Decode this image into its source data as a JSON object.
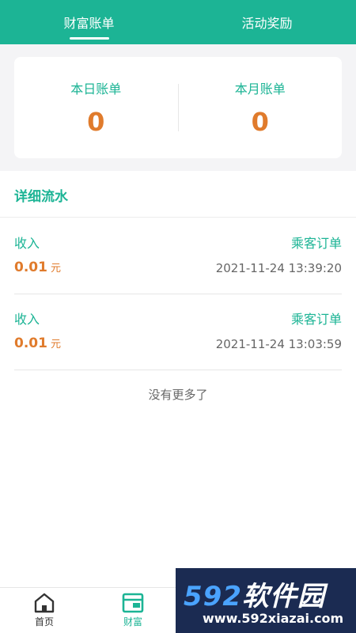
{
  "tabs": [
    {
      "label": "财富账单",
      "active": true
    },
    {
      "label": "活动奖励",
      "active": false
    }
  ],
  "summary": {
    "daily_label": "本日账单",
    "daily_value": "0",
    "monthly_label": "本月账单",
    "monthly_value": "0"
  },
  "detail": {
    "title": "详细流水",
    "records": [
      {
        "type": "收入",
        "source": "乘客订单",
        "amount": "0.01",
        "unit": "元",
        "time": "2021-11-24 13:39:20"
      },
      {
        "type": "收入",
        "source": "乘客订单",
        "amount": "0.01",
        "unit": "元",
        "time": "2021-11-24 13:03:59"
      }
    ],
    "no_more": "没有更多了"
  },
  "bottom_nav": [
    {
      "label": "首页",
      "icon": "home-icon",
      "active": false
    },
    {
      "label": "财富",
      "icon": "wallet-icon",
      "active": true
    }
  ],
  "watermark": {
    "logo_digits": "592",
    "logo_text": "软件园",
    "url": "www.592xiazai.com"
  },
  "colors": {
    "accent": "#1cb495",
    "amount": "#e07b2c"
  }
}
